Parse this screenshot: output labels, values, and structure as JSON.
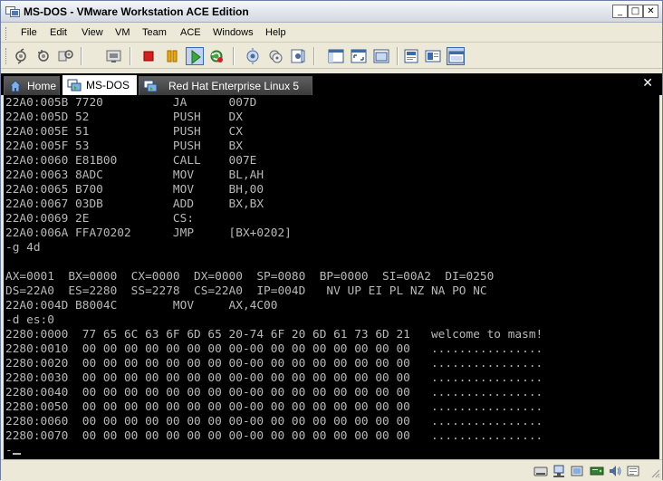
{
  "window": {
    "title": "MS-DOS - VMware Workstation ACE Edition",
    "minimize_glyph": "_",
    "maximize_glyph": "□",
    "close_glyph": "✕"
  },
  "menu": {
    "items": [
      {
        "label": "File"
      },
      {
        "label": "Edit"
      },
      {
        "label": "View"
      },
      {
        "label": "VM"
      },
      {
        "label": "Team"
      },
      {
        "label": "ACE"
      },
      {
        "label": "Windows"
      },
      {
        "label": "Help"
      }
    ]
  },
  "toolbar": {
    "buttons": [
      {
        "icon": "snapshot-take-icon"
      },
      {
        "icon": "snapshot-revert-icon"
      },
      {
        "icon": "snapshot-manager-icon"
      },
      {
        "icon": "send-ctrl-alt-del-icon"
      },
      {
        "icon": "power-off-icon"
      },
      {
        "icon": "suspend-icon"
      },
      {
        "icon": "power-on-icon"
      },
      {
        "icon": "reset-icon"
      },
      {
        "icon": "team-icon"
      },
      {
        "icon": "clone-icon"
      },
      {
        "icon": "preferences-icon"
      },
      {
        "icon": "sidebar-toggle-icon"
      },
      {
        "icon": "fullscreen-icon"
      },
      {
        "icon": "quick-switch-icon"
      },
      {
        "icon": "summary-view-icon"
      },
      {
        "icon": "console-view-icon"
      },
      {
        "icon": "tabs-view-icon"
      }
    ]
  },
  "tabs": {
    "items": [
      {
        "label": "Home",
        "icon": "home-icon"
      },
      {
        "label": "MS-DOS",
        "icon": "vm-icon",
        "active": true
      },
      {
        "label": "Red Hat Enterprise Linux 5",
        "icon": "vm-icon"
      }
    ],
    "close_glyph": "✕"
  },
  "console": {
    "lines": [
      "22A0:005B 7720          JA      007D",
      "22A0:005D 52            PUSH    DX",
      "22A0:005E 51            PUSH    CX",
      "22A0:005F 53            PUSH    BX",
      "22A0:0060 E81B00        CALL    007E",
      "22A0:0063 8ADC          MOV     BL,AH",
      "22A0:0065 B700          MOV     BH,00",
      "22A0:0067 03DB          ADD     BX,BX",
      "22A0:0069 2E            CS:",
      "22A0:006A FFA70202      JMP     [BX+0202]",
      "-g 4d",
      "",
      "AX=0001  BX=0000  CX=0000  DX=0000  SP=0080  BP=0000  SI=00A2  DI=0250",
      "DS=22A0  ES=2280  SS=2278  CS=22A0  IP=004D   NV UP EI PL NZ NA PO NC",
      "22A0:004D B8004C        MOV     AX,4C00",
      "-d es:0",
      "2280:0000  77 65 6C 63 6F 6D 65 20-74 6F 20 6D 61 73 6D 21   welcome to masm!",
      "2280:0010  00 00 00 00 00 00 00 00-00 00 00 00 00 00 00 00   ................",
      "2280:0020  00 00 00 00 00 00 00 00-00 00 00 00 00 00 00 00   ................",
      "2280:0030  00 00 00 00 00 00 00 00-00 00 00 00 00 00 00 00   ................",
      "2280:0040  00 00 00 00 00 00 00 00-00 00 00 00 00 00 00 00   ................",
      "2280:0050  00 00 00 00 00 00 00 00-00 00 00 00 00 00 00 00   ................",
      "2280:0060  00 00 00 00 00 00 00 00-00 00 00 00 00 00 00 00   ................",
      "2280:0070  00 00 00 00 00 00 00 00-00 00 00 00 00 00 00 00   ................",
      "-"
    ],
    "text_color": "#b8b8b8",
    "background": "#000000"
  },
  "statusbar": {
    "icons": [
      {
        "icon": "floppy-drive-icon"
      },
      {
        "icon": "network-adapter-icon"
      },
      {
        "icon": "usb-device-icon"
      },
      {
        "icon": "hard-disk-icon"
      },
      {
        "icon": "sound-icon"
      },
      {
        "icon": "message-log-icon"
      }
    ]
  }
}
